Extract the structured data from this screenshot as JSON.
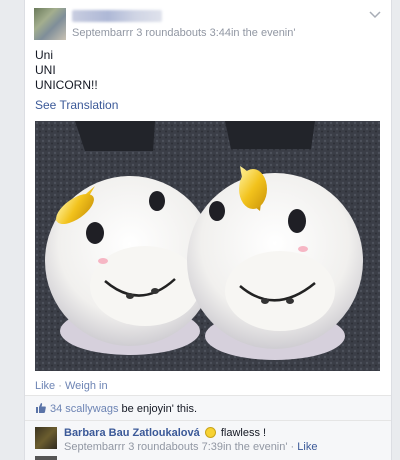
{
  "post": {
    "meta": "Septembarrr 3 roundabouts 3:44in the evenin'",
    "text_lines": [
      "Uni",
      "UNI",
      "UNICORN!!"
    ],
    "see_translation": "See Translation"
  },
  "actions": {
    "like": "Like",
    "separator": "·",
    "weigh_in": "Weigh in"
  },
  "likes": {
    "count_text": "34 scallywags",
    "suffix": " be enjoyin' this."
  },
  "comment": {
    "author": "Barbara Bau Zatloukalová",
    "text": " flawless !",
    "time": "Septembarrr 3 roundabouts 7:39in the evenin'",
    "dot": " · ",
    "like": "Like"
  },
  "colors": {
    "link": "#3b5998",
    "muted": "#9197a3",
    "action_link": "#6d84b4"
  },
  "icons": {
    "chevron": "chevron-down-icon",
    "thumb": "thumbs-up-icon",
    "smiley": "smiley-icon"
  }
}
